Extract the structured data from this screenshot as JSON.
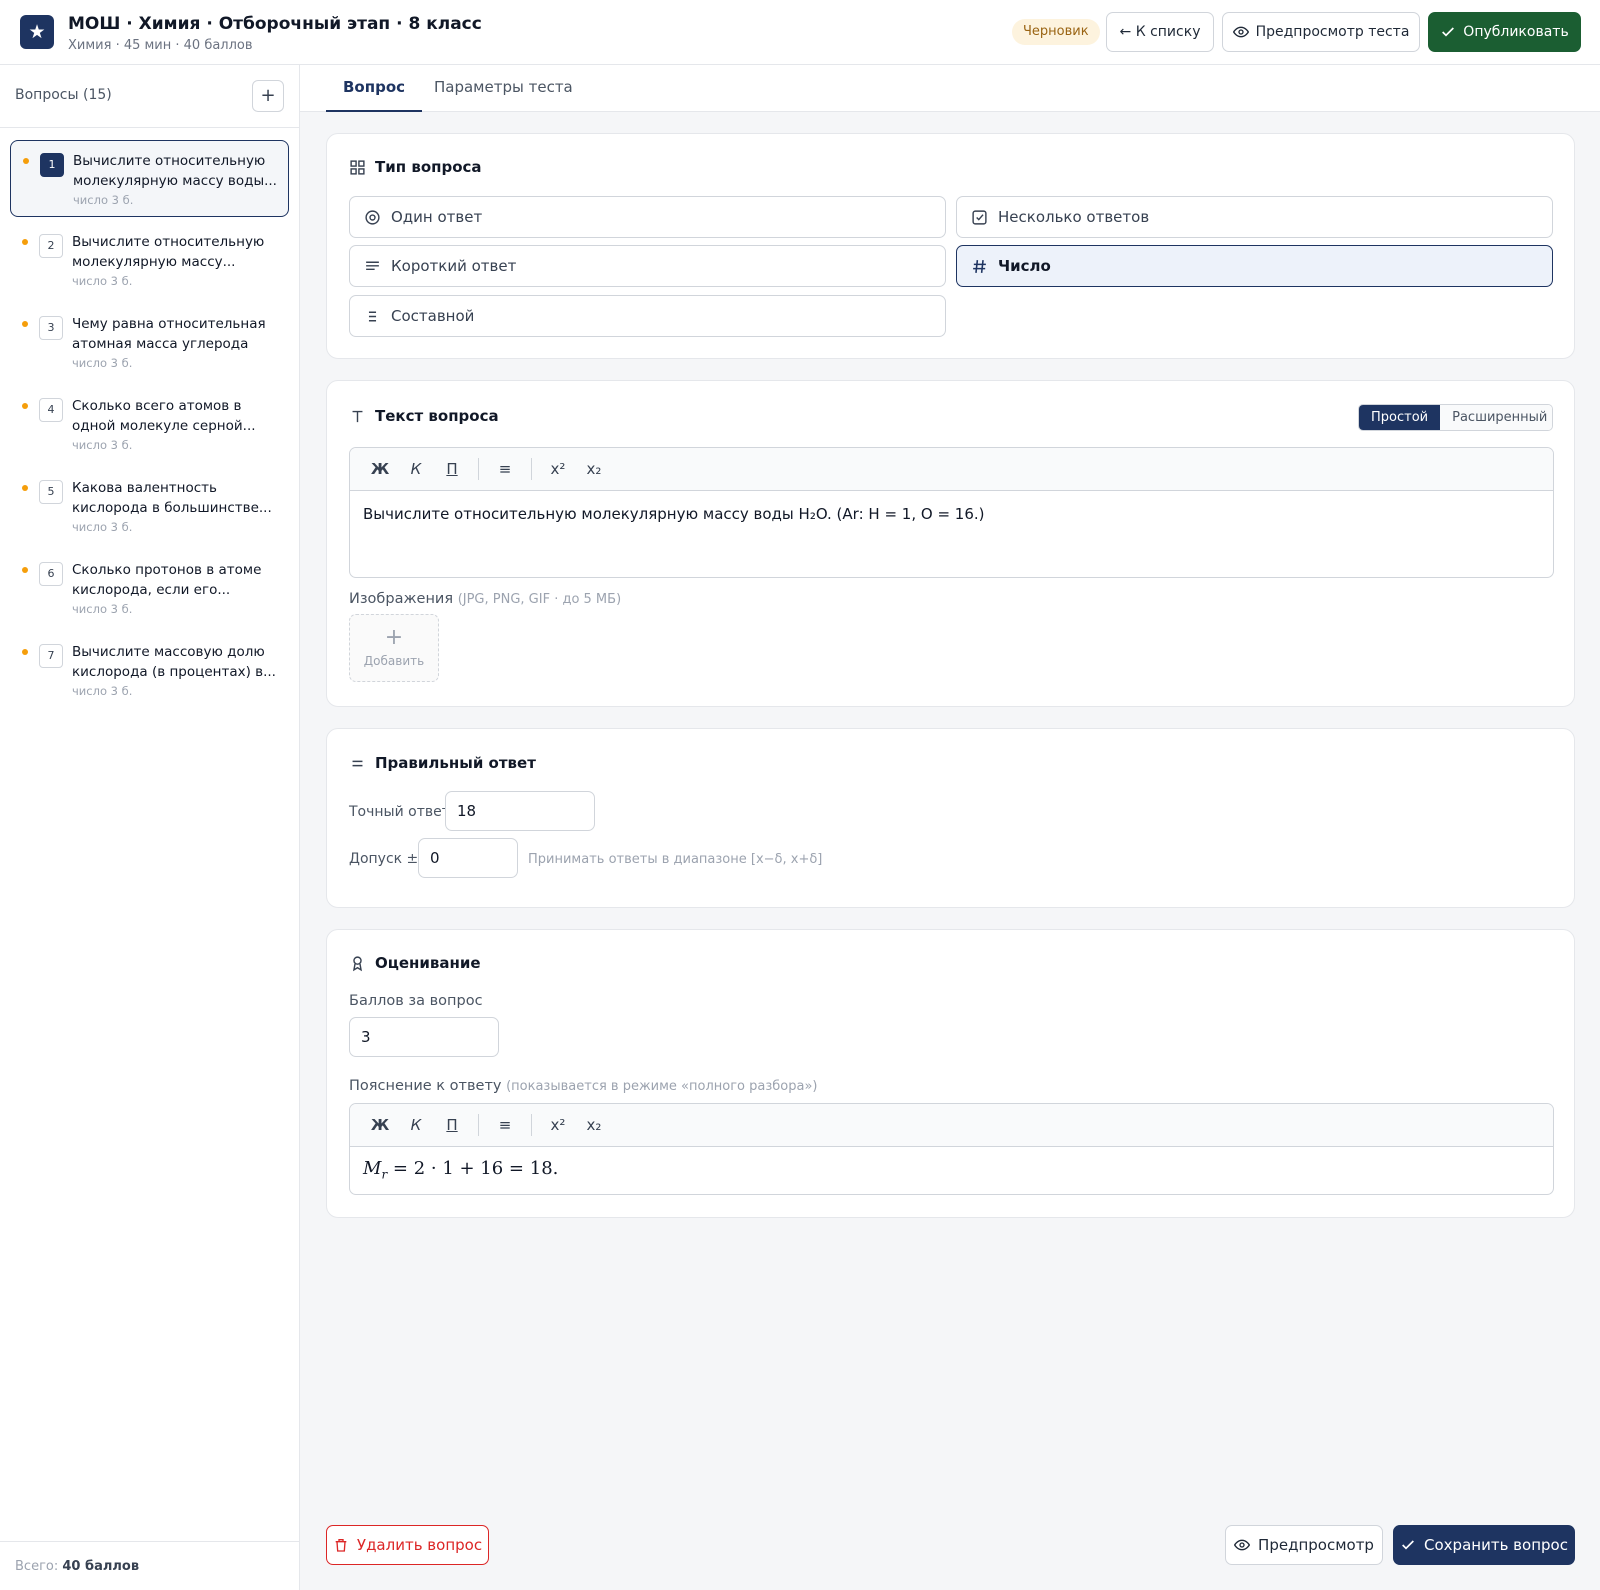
{
  "header": {
    "logo_glyph": "★",
    "title": "МОШ · Химия · Отборочный этап · 8 класс",
    "subtitle": "Химия · 45 мин · 40 баллов",
    "status_badge": "Черновик",
    "back_label": "← К списку",
    "preview_label": "Предпросмотр теста",
    "publish_label": "Опубликовать"
  },
  "sidebar": {
    "title": "Вопросы (15)",
    "add_label": "+",
    "total_label": "Всего:",
    "total_value": "40 баллов",
    "questions": [
      {
        "num": "1",
        "text": "Вычислите относительную молекулярную массу воды...",
        "meta": "число  3 б."
      },
      {
        "num": "2",
        "text": "Вычислите относительную молекулярную массу...",
        "meta": "число  3 б."
      },
      {
        "num": "3",
        "text": "Чему равна относительная атомная масса углерода (Ar)?",
        "meta": "число  3 б."
      },
      {
        "num": "4",
        "text": "Сколько всего атомов в одной молекуле серной...",
        "meta": "число  3 б."
      },
      {
        "num": "5",
        "text": "Какова валентность кислорода в большинстве...",
        "meta": "число  3 б."
      },
      {
        "num": "6",
        "text": "Сколько протонов в атоме кислорода, если его...",
        "meta": "число  3 б."
      },
      {
        "num": "7",
        "text": "Вычислите массовую долю кислорода (в процентах) в...",
        "meta": "число  3 б."
      }
    ]
  },
  "tabs": [
    "Вопрос",
    "Параметры теста"
  ],
  "question_type": {
    "title": "Тип вопроса",
    "options": [
      "Один ответ",
      "Несколько ответов",
      "Короткий ответ",
      "Число",
      "Составной"
    ],
    "selected": "Число"
  },
  "question_text": {
    "title": "Текст вопроса",
    "mode_simple": "Простой",
    "mode_advanced": "Расширенный",
    "toolbar": [
      "Ж",
      "К",
      "П",
      "≡",
      "x²",
      "x₂"
    ],
    "body": "Вычислите относительную молекулярную массу воды H₂O. (Ar: H = 1, O = 16.)",
    "images_label": "Изображения",
    "images_hint": "(JPG, PNG, GIF · до 5 МБ)",
    "upload_plus": "+",
    "upload_label": "Добавить"
  },
  "correct_answer": {
    "title": "Правильный ответ",
    "exact_label": "Точный ответ",
    "exact_value": "18",
    "tolerance_label": "Допуск ±",
    "tolerance_value": "0",
    "tolerance_hint": "Принимать ответы в диапазоне [x−δ, x+δ]"
  },
  "grading": {
    "title": "Оценивание",
    "points_label": "Баллов за вопрос",
    "points_value": "3",
    "explanation_label": "Пояснение к ответу",
    "explanation_hint": "(показывается в режиме «полного разбора»)",
    "explanation_parts": [
      "M",
      "r",
      " = 2 · 1 + 16 = 18."
    ]
  },
  "footer": {
    "delete_label": "Удалить вопрос",
    "preview_label": "Предпросмотр",
    "save_label": "Сохранить вопрос"
  },
  "colors": {
    "accent": "#1e3461",
    "publish": "#1b5e32",
    "danger": "#dc2626",
    "draft_badge_bg": "#fdf3de",
    "unsaved_dot": "#f59e0b"
  }
}
